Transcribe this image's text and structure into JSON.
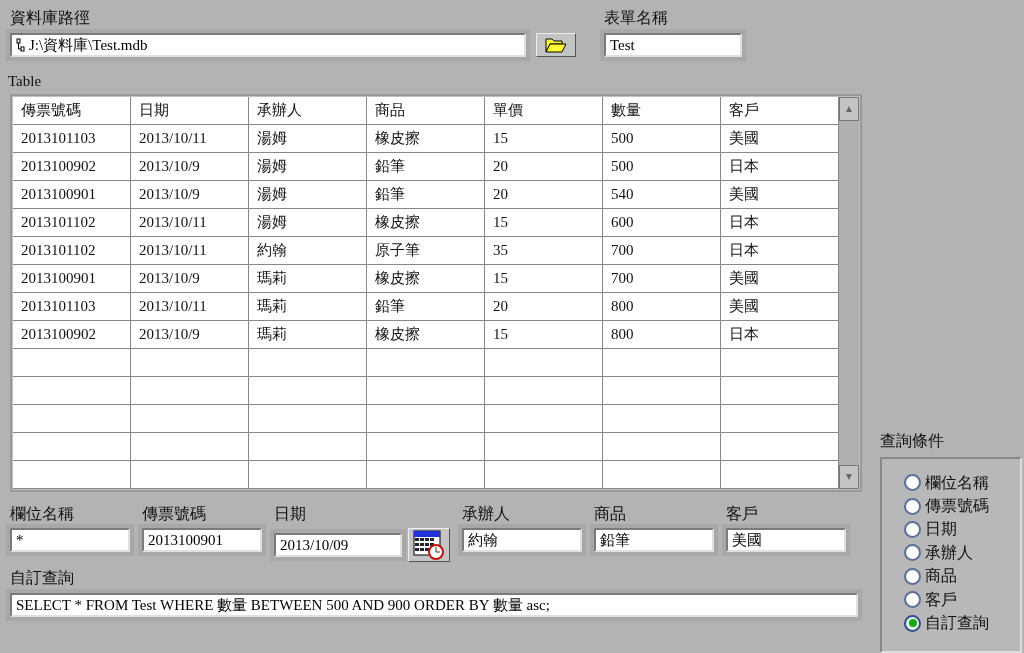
{
  "db_path": {
    "label": "資料庫路徑",
    "value": "J:\\資料庫\\Test.mdb"
  },
  "form_name": {
    "label": "表單名稱",
    "value": "Test"
  },
  "table": {
    "label": "Table",
    "columns": [
      "傳票號碼",
      "日期",
      "承辦人",
      "商品",
      "單價",
      "數量",
      "客戶"
    ],
    "rows": [
      [
        "2013101103",
        "2013/10/11",
        "湯姆",
        "橡皮擦",
        "15",
        "500",
        "美國"
      ],
      [
        "2013100902",
        "2013/10/9",
        "湯姆",
        "鉛筆",
        "20",
        "500",
        "日本"
      ],
      [
        "2013100901",
        "2013/10/9",
        "湯姆",
        "鉛筆",
        "20",
        "540",
        "美國"
      ],
      [
        "2013101102",
        "2013/10/11",
        "湯姆",
        "橡皮擦",
        "15",
        "600",
        "日本"
      ],
      [
        "2013101102",
        "2013/10/11",
        "約翰",
        "原子筆",
        "35",
        "700",
        "日本"
      ],
      [
        "2013100901",
        "2013/10/9",
        "瑪莉",
        "橡皮擦",
        "15",
        "700",
        "美國"
      ],
      [
        "2013101103",
        "2013/10/11",
        "瑪莉",
        "鉛筆",
        "20",
        "800",
        "美國"
      ],
      [
        "2013100902",
        "2013/10/9",
        "瑪莉",
        "橡皮擦",
        "15",
        "800",
        "日本"
      ]
    ]
  },
  "filters": [
    {
      "label": "欄位名稱",
      "value": "*",
      "kind": "text"
    },
    {
      "label": "傳票號碼",
      "value": "2013100901",
      "kind": "text"
    },
    {
      "label": "日期",
      "value": "2013/10/09",
      "kind": "date"
    },
    {
      "label": "承辦人",
      "value": "約翰",
      "kind": "text"
    },
    {
      "label": "商品",
      "value": "鉛筆",
      "kind": "text"
    },
    {
      "label": "客戶",
      "value": "美國",
      "kind": "text"
    }
  ],
  "custom_query": {
    "label": "自訂查詢",
    "value": "SELECT * FROM Test WHERE 數量 BETWEEN 500 AND 900 ORDER BY 數量 asc;"
  },
  "query_condition": {
    "label": "查詢條件",
    "options": [
      {
        "label": "欄位名稱",
        "selected": false
      },
      {
        "label": "傳票號碼",
        "selected": false
      },
      {
        "label": "日期",
        "selected": false
      },
      {
        "label": "承辦人",
        "selected": false
      },
      {
        "label": "商品",
        "selected": false
      },
      {
        "label": "客戶",
        "selected": false
      },
      {
        "label": "自訂查詢",
        "selected": true
      }
    ]
  }
}
